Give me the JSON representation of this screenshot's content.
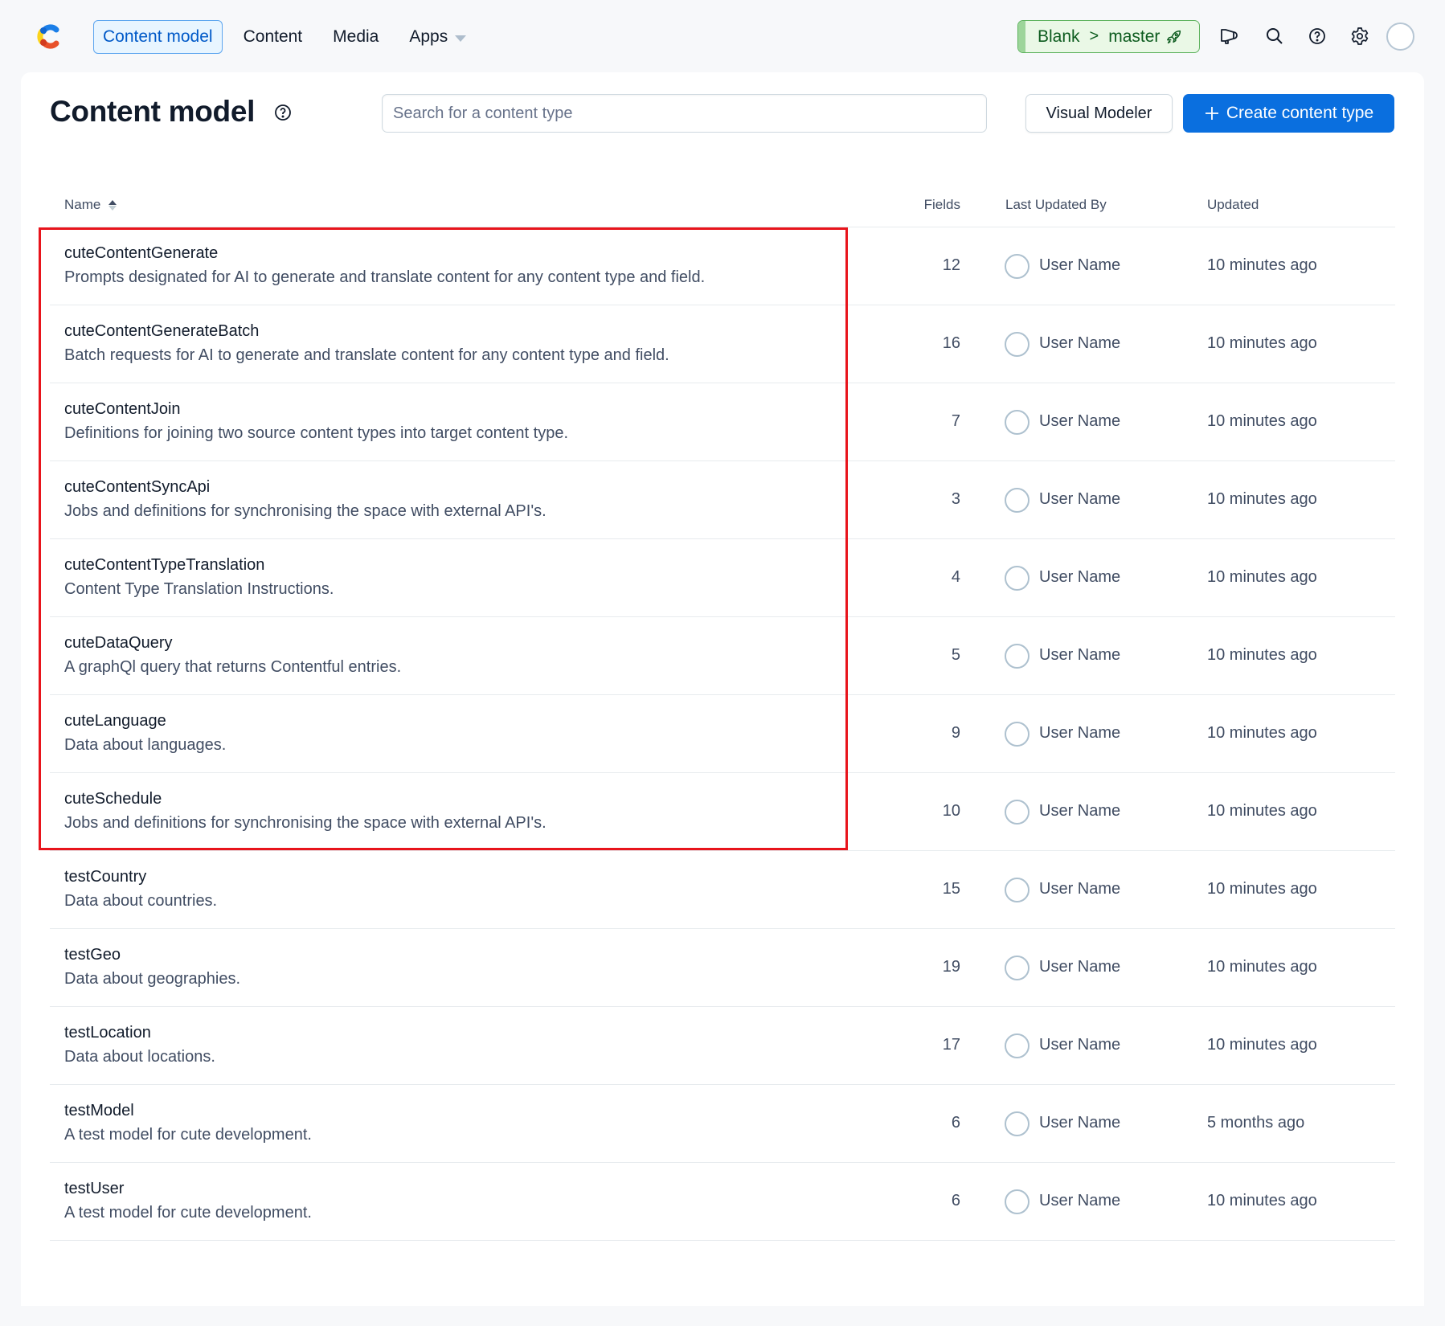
{
  "nav": {
    "logo": "contentful-logo",
    "tabs": [
      {
        "label": "Content model",
        "active": true
      },
      {
        "label": "Content",
        "active": false
      },
      {
        "label": "Media",
        "active": false
      },
      {
        "label": "Apps",
        "active": false,
        "dropdown": true
      }
    ],
    "environment": {
      "space": "Blank",
      "separator": ">",
      "env": "master",
      "icon": "rocket-icon",
      "color": "#0c5b1e"
    },
    "icons": [
      "megaphone-icon",
      "search-icon",
      "help-icon",
      "gear-icon",
      "avatar"
    ]
  },
  "page": {
    "title": "Content model",
    "help_icon": "help-icon",
    "search": {
      "placeholder": "Search for a content type",
      "value": ""
    },
    "visual_modeler_label": "Visual Modeler",
    "create_label": "Create content type",
    "accent": "#0a6fdf"
  },
  "table": {
    "columns": {
      "name": "Name",
      "fields": "Fields",
      "last_updated_by": "Last Updated By",
      "updated": "Updated"
    },
    "sort": {
      "column": "Name",
      "direction": "ascending"
    },
    "rows": [
      {
        "name": "cuteContentGenerate",
        "description": "Prompts designated for AI to generate and translate content for any content type and field.",
        "fields": "12",
        "user": "User Name",
        "updated": "10 minutes ago"
      },
      {
        "name": "cuteContentGenerateBatch",
        "description": "Batch requests for AI to generate and translate content for any content type and field.",
        "fields": "16",
        "user": "User Name",
        "updated": "10 minutes ago"
      },
      {
        "name": "cuteContentJoin",
        "description": "Definitions for joining two source content types into target content type.",
        "fields": "7",
        "user": "User Name",
        "updated": "10 minutes ago"
      },
      {
        "name": "cuteContentSyncApi",
        "description": "Jobs and definitions for synchronising the space with external API's.",
        "fields": "3",
        "user": "User Name",
        "updated": "10 minutes ago"
      },
      {
        "name": "cuteContentTypeTranslation",
        "description": "Content Type Translation Instructions.",
        "fields": "4",
        "user": "User Name",
        "updated": "10 minutes ago"
      },
      {
        "name": "cuteDataQuery",
        "description": "A graphQl query that returns Contentful entries.",
        "fields": "5",
        "user": "User Name",
        "updated": "10 minutes ago"
      },
      {
        "name": "cuteLanguage",
        "description": "Data about languages.",
        "fields": "9",
        "user": "User Name",
        "updated": "10 minutes ago"
      },
      {
        "name": "cuteSchedule",
        "description": "Jobs and definitions for synchronising the space with external API's.",
        "fields": "10",
        "user": "User Name",
        "updated": "10 minutes ago"
      },
      {
        "name": "testCountry",
        "description": "Data about countries.",
        "fields": "15",
        "user": "User Name",
        "updated": "10 minutes ago"
      },
      {
        "name": "testGeo",
        "description": "Data about geographies.",
        "fields": "19",
        "user": "User Name",
        "updated": "10 minutes ago"
      },
      {
        "name": "testLocation",
        "description": "Data about locations.",
        "fields": "17",
        "user": "User Name",
        "updated": "10 minutes ago"
      },
      {
        "name": "testModel",
        "description": "A test model for cute development.",
        "fields": "6",
        "user": "User Name",
        "updated": "5 months ago"
      },
      {
        "name": "testUser",
        "description": "A test model for cute development.",
        "fields": "6",
        "user": "User Name",
        "updated": "10 minutes ago"
      }
    ]
  },
  "annotation": {
    "highlight_color": "#e8141c",
    "highlighted_rows": "cuteContentGenerate through cuteSchedule"
  }
}
